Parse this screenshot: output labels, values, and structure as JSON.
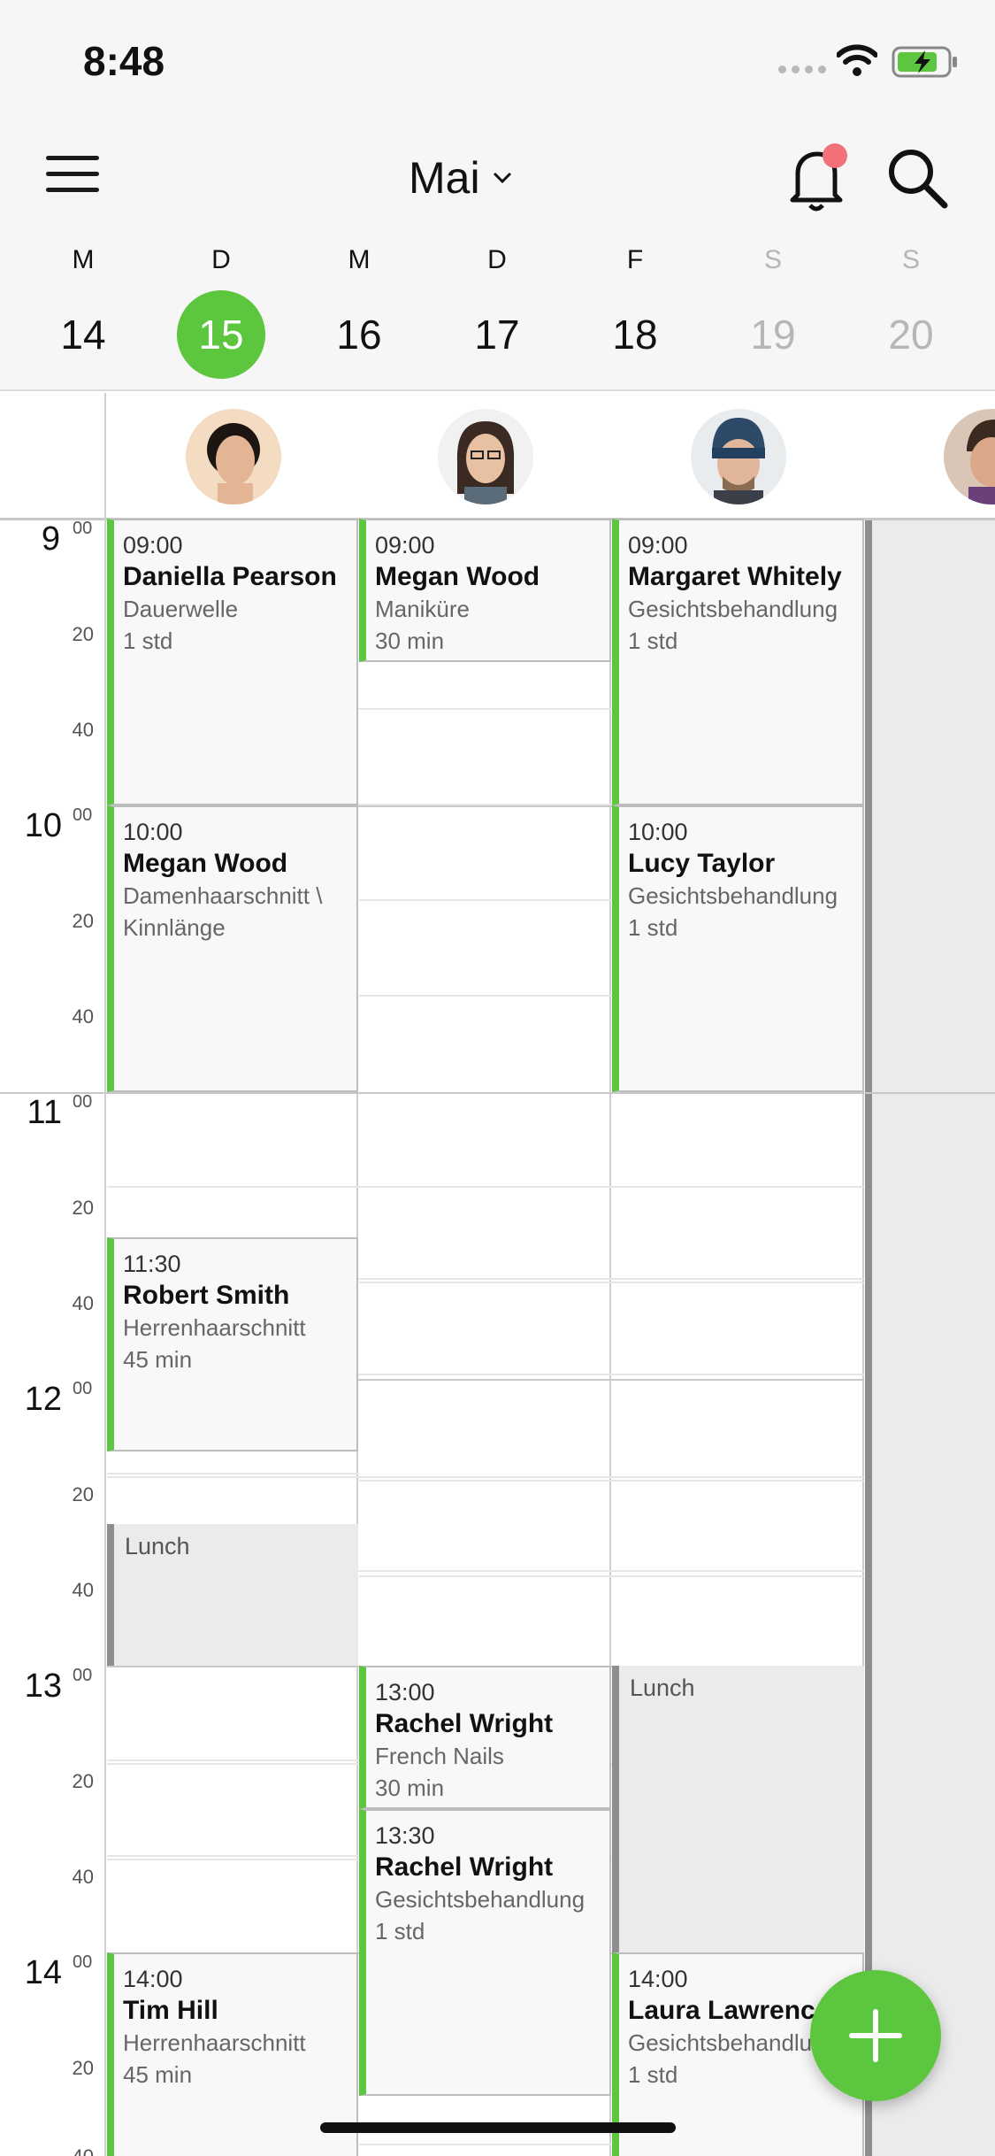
{
  "status_bar": {
    "time": "8:48"
  },
  "header": {
    "month": "Mai",
    "icons": {
      "menu": "hamburger-menu-icon",
      "notifications": "bell-icon",
      "search": "search-icon"
    },
    "accent": "#5bc63e",
    "notification_dot_color": "#f2707a"
  },
  "week": [
    {
      "dow": "M",
      "num": "14"
    },
    {
      "dow": "D",
      "num": "15",
      "selected": true
    },
    {
      "dow": "M",
      "num": "16"
    },
    {
      "dow": "D",
      "num": "17"
    },
    {
      "dow": "F",
      "num": "18"
    },
    {
      "dow": "S",
      "num": "19"
    },
    {
      "dow": "S",
      "num": "20"
    }
  ],
  "time_labels": {
    "top_minute": "40",
    "hours": [
      "9",
      "10",
      "11",
      "12",
      "13",
      "14"
    ],
    "zero": "00",
    "m20": "20",
    "m40": "40"
  },
  "appointments": {
    "a1": {
      "time": "09:00",
      "name": "Daniella Pearson",
      "service": "Dauerwelle",
      "duration": "1 std"
    },
    "a2": {
      "time": "10:00",
      "name": "Megan Wood",
      "service": "Damenhaarschnitt \\",
      "duration": "Kinnlänge"
    },
    "a3": {
      "time": "11:30",
      "name": "Robert Smith",
      "service": "Herrenhaarschnitt",
      "duration": "45 min"
    },
    "a4": {
      "time": "14:00",
      "name": "Tim Hill",
      "service": "Herrenhaarschnitt",
      "duration": "45 min"
    },
    "b1": {
      "time": "09:00",
      "name": "Megan Wood",
      "service": "Maniküre",
      "duration": "30 min"
    },
    "b2": {
      "time": "13:00",
      "name": "Rachel Wright",
      "service": "French Nails",
      "duration": "30 min"
    },
    "b3": {
      "time": "13:30",
      "name": "Rachel Wright",
      "service": "Gesichtsbehandlung",
      "duration": "1 std"
    },
    "c1": {
      "time": "09:00",
      "name": "Margaret Whitely",
      "service": "Gesichtsbehandlung",
      "duration": "1 std"
    },
    "c2": {
      "time": "10:00",
      "name": "Lucy Taylor",
      "service": "Gesichtsbehandlung",
      "duration": "1 std"
    },
    "c3": {
      "time": "14:00",
      "name": "Laura Lawrence",
      "service": "Gesichtsbehandlung",
      "duration": "1 std"
    }
  },
  "blocks": {
    "lunch1": "Lunch",
    "lunch2": "Lunch"
  }
}
